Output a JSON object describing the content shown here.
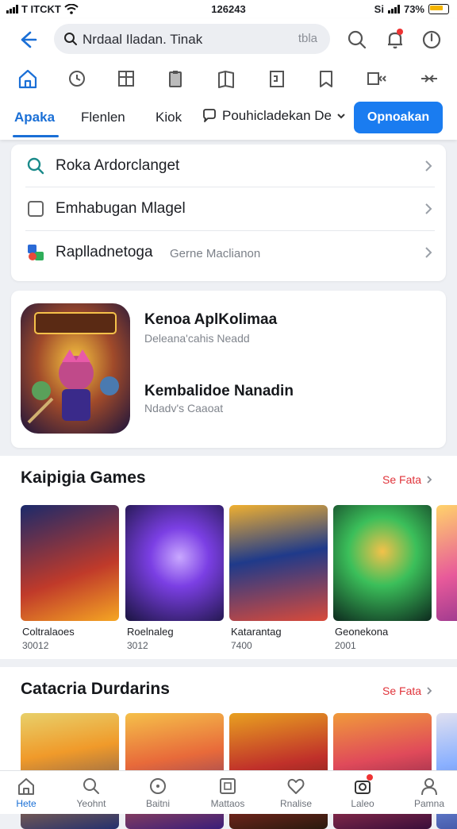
{
  "status_bar": {
    "carrier": "T ITCKT",
    "time": "126243",
    "right_text": "Si",
    "battery": "73%"
  },
  "search": {
    "value": "Nrdaal Iladan. Tinak",
    "hint": "tbla"
  },
  "tabs": [
    {
      "label": "Apaka",
      "active": true
    },
    {
      "label": "Flenlen",
      "active": false
    },
    {
      "label": "Kiok",
      "active": false
    }
  ],
  "dropdown": {
    "label": "Pouhicladekan De"
  },
  "open_button": {
    "label": "Opnoakan"
  },
  "menu": [
    {
      "icon": "search-icon",
      "label": "Roka Ardorclanget",
      "sub": ""
    },
    {
      "icon": "checkbox-icon",
      "label": "Emhabugan Mlagel",
      "sub": ""
    },
    {
      "icon": "apps-icon",
      "label": "Raplladnetoga",
      "sub": "Gerne Maclianon"
    }
  ],
  "featured": {
    "title1": "Kenoa AplKolimaa",
    "sub1": "Deleana'cahis Neadd",
    "title2": "Kembalidoe Nanadin",
    "sub2": "Ndadv's Caaoat"
  },
  "section1": {
    "title": "Kaipigia Games",
    "see_all": "Se Fata",
    "games": [
      {
        "name": "Coltralaoes",
        "meta": "30012",
        "colors": [
          "#1b2a6b",
          "#c03a2a",
          "#f5a623"
        ]
      },
      {
        "name": "Roelnaleg",
        "meta": "3012",
        "colors": [
          "#1a1440",
          "#7b3fe4",
          "#c9a8ff"
        ]
      },
      {
        "name": "Katarantag",
        "meta": "7400",
        "colors": [
          "#1f3a8a",
          "#f0b030",
          "#d94a3a"
        ]
      },
      {
        "name": "Geonekona",
        "meta": "2001",
        "colors": [
          "#0d2a1e",
          "#3bbf5a",
          "#f3c14a"
        ]
      },
      {
        "name": "Tr",
        "meta": "",
        "colors": [
          "#7a2a8a",
          "#e85a9a",
          "#ffd36a"
        ]
      }
    ]
  },
  "section2": {
    "title": "Catacria Durdarins",
    "see_all": "Se Fata",
    "games": [
      {
        "colors": [
          "#24306e",
          "#f09a2a",
          "#e8d06a"
        ]
      },
      {
        "colors": [
          "#3a1d7a",
          "#e86a3a",
          "#f5c04a"
        ]
      },
      {
        "colors": [
          "#2a1a0e",
          "#e8a020",
          "#c0302a"
        ]
      },
      {
        "colors": [
          "#3a0e3a",
          "#e04a5a",
          "#f09a3a"
        ]
      },
      {
        "colors": [
          "#3a4a9a",
          "#e0e0f0",
          "#8ab0ff"
        ]
      }
    ]
  },
  "bottom_nav": [
    {
      "icon": "home-icon",
      "label": "Hete",
      "active": true
    },
    {
      "icon": "search-icon",
      "label": "Yeohnt",
      "active": false
    },
    {
      "icon": "compass-icon",
      "label": "Baitni",
      "active": false
    },
    {
      "icon": "square-icon",
      "label": "Mattaos",
      "active": false
    },
    {
      "icon": "heart-icon",
      "label": "Rnalise",
      "active": false
    },
    {
      "icon": "camera-icon",
      "label": "Laleo",
      "active": false
    },
    {
      "icon": "person-icon",
      "label": "Pamna",
      "active": false
    }
  ],
  "colors": {
    "accent": "#1a7cf0",
    "see_all": "#e0333a"
  }
}
